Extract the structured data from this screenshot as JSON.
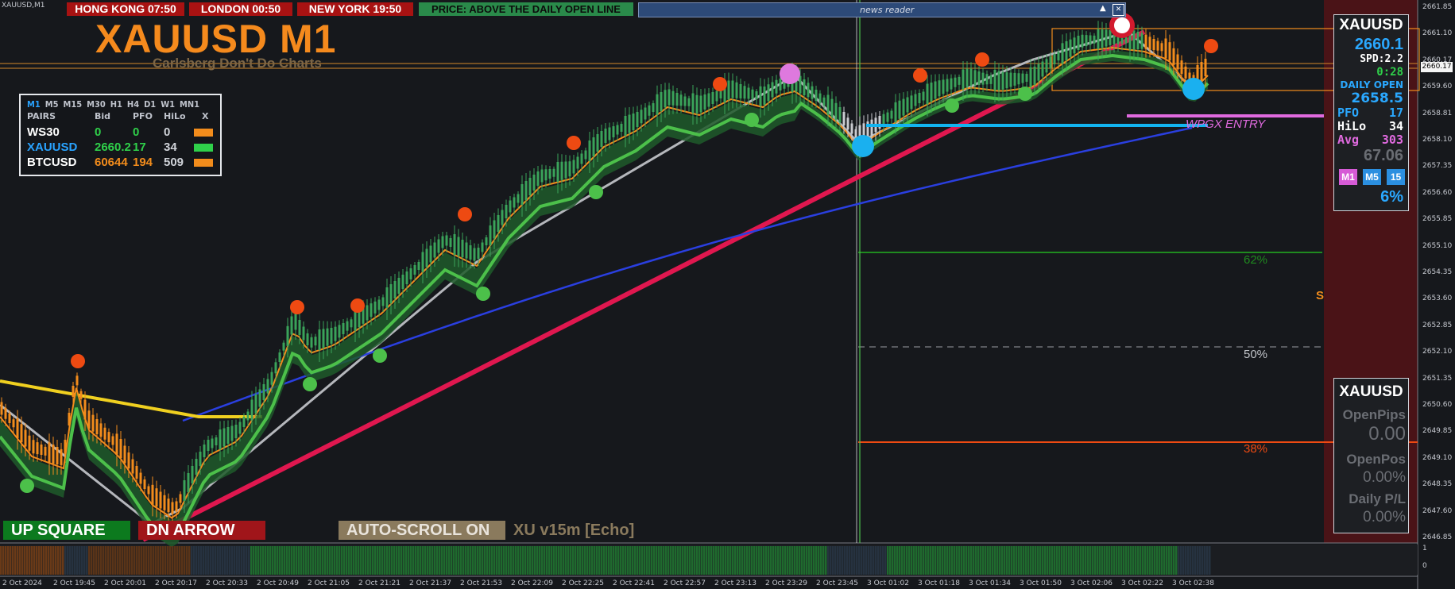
{
  "window_tab": "XAUUSD,M1",
  "clocks": [
    {
      "label": "HONG KONG 07:50"
    },
    {
      "label": "LONDON  00:50"
    },
    {
      "label": "NEW YORK  19:50"
    }
  ],
  "price_status": "PRICE: ABOVE THE DAILY OPEN LINE",
  "news_reader": {
    "title": "news reader",
    "minimize": "▲",
    "close": "✕"
  },
  "title": {
    "main": "XAUUSD M1",
    "subtitle": "Carlsberg Don't Do Charts"
  },
  "pairs_table": {
    "timeframes": [
      "M1",
      "M5",
      "M15",
      "M30",
      "H1",
      "H4",
      "D1",
      "W1",
      "MN1"
    ],
    "headers": [
      "PAIRS",
      "Bid",
      "PFO",
      "HiLo",
      "X"
    ],
    "rows": [
      {
        "pair": "WS30",
        "bid": "0",
        "pfo": "0",
        "hilo": "0",
        "pair_color": "#ffffff",
        "val_color": "#2fd04a",
        "swatch": "#f28c1c"
      },
      {
        "pair": "XAUUSD",
        "bid": "2660.2",
        "pfo": "17",
        "hilo": "34",
        "pair_color": "#29a3ff",
        "val_color": "#2fd04a",
        "swatch": "#2fd04a"
      },
      {
        "pair": "BTCUSD",
        "bid": "60644",
        "pfo": "194",
        "hilo": "509",
        "pair_color": "#ffffff",
        "val_color": "#f28c1c",
        "swatch": "#f28c1c"
      }
    ]
  },
  "side_panel": {
    "symbol": "XAUUSD",
    "price": "2660.1",
    "spread": "SPD:2.2",
    "timer": "0:28",
    "daily_open_label": "DAILY OPEN",
    "daily_open_value": "2658.5",
    "pfo_label": "PFO",
    "pfo_value": "17",
    "hilo_label": "HiLo",
    "hilo_value": "34",
    "avg_label": "Avg",
    "avg_value": "303",
    "ratio": "67.06",
    "tf_buttons": [
      {
        "label": "M1",
        "color": "#d65bd6"
      },
      {
        "label": "M5",
        "color": "#2b8fe0"
      },
      {
        "label": "15",
        "color": "#2b8fe0"
      }
    ],
    "percent": "6%"
  },
  "account_panel": {
    "symbol": "XAUUSD",
    "open_pips_label": "OpenPips",
    "open_pips_value": "0.00",
    "open_pos_label": "OpenPos",
    "open_pos_value": "0.00%",
    "daily_pl_label": "Daily P/L",
    "daily_pl_value": "0.00%"
  },
  "bottom": {
    "up_square": "UP SQUARE",
    "dn_arrow": "DN ARROW",
    "autoscroll": "AUTO-SCROLL ON",
    "version": "XU v15m [Echo]"
  },
  "labels": {
    "fib62": "62%",
    "fib50": "50%",
    "fib38": "38%",
    "entry": "WPGX ENTRY",
    "s_mark": "S"
  },
  "price_axis": [
    "2661.85",
    "2661.10",
    "2660.17",
    "2659.60",
    "2658.81",
    "2658.10",
    "2657.35",
    "2656.60",
    "2655.85",
    "2655.10",
    "2654.35",
    "2653.60",
    "2652.85",
    "2652.10",
    "2651.35",
    "2650.60",
    "2649.85",
    "2649.10",
    "2648.35",
    "2647.60",
    "2646.85"
  ],
  "current_price_tag": "2660.17",
  "time_axis": [
    "2 Oct 2024",
    "2 Oct 19:45",
    "2 Oct 20:01",
    "2 Oct 20:17",
    "2 Oct 20:33",
    "2 Oct 20:49",
    "2 Oct 21:05",
    "2 Oct 21:21",
    "2 Oct 21:37",
    "2 Oct 21:53",
    "2 Oct 22:09",
    "2 Oct 22:25",
    "2 Oct 22:41",
    "2 Oct 22:57",
    "2 Oct 23:13",
    "2 Oct 23:29",
    "2 Oct 23:45",
    "3 Oct 01:02",
    "3 Oct 01:18",
    "3 Oct 01:34",
    "3 Oct 01:50",
    "3 Oct 02:06",
    "3 Oct 02:22",
    "3 Oct 02:38"
  ],
  "sub_axis": [
    "1",
    "0"
  ],
  "colors": {
    "bull": "#3aa35a",
    "bear": "#f28c1c",
    "ema_fast": "#f28c1c",
    "ema_mid": "#4cc04a",
    "ema_slow": "#2a3fe0",
    "ema_yellow": "#f0d020",
    "trend": "#e0174f",
    "entry_line": "#12b4f0",
    "pink_line": "#e06adf"
  }
}
